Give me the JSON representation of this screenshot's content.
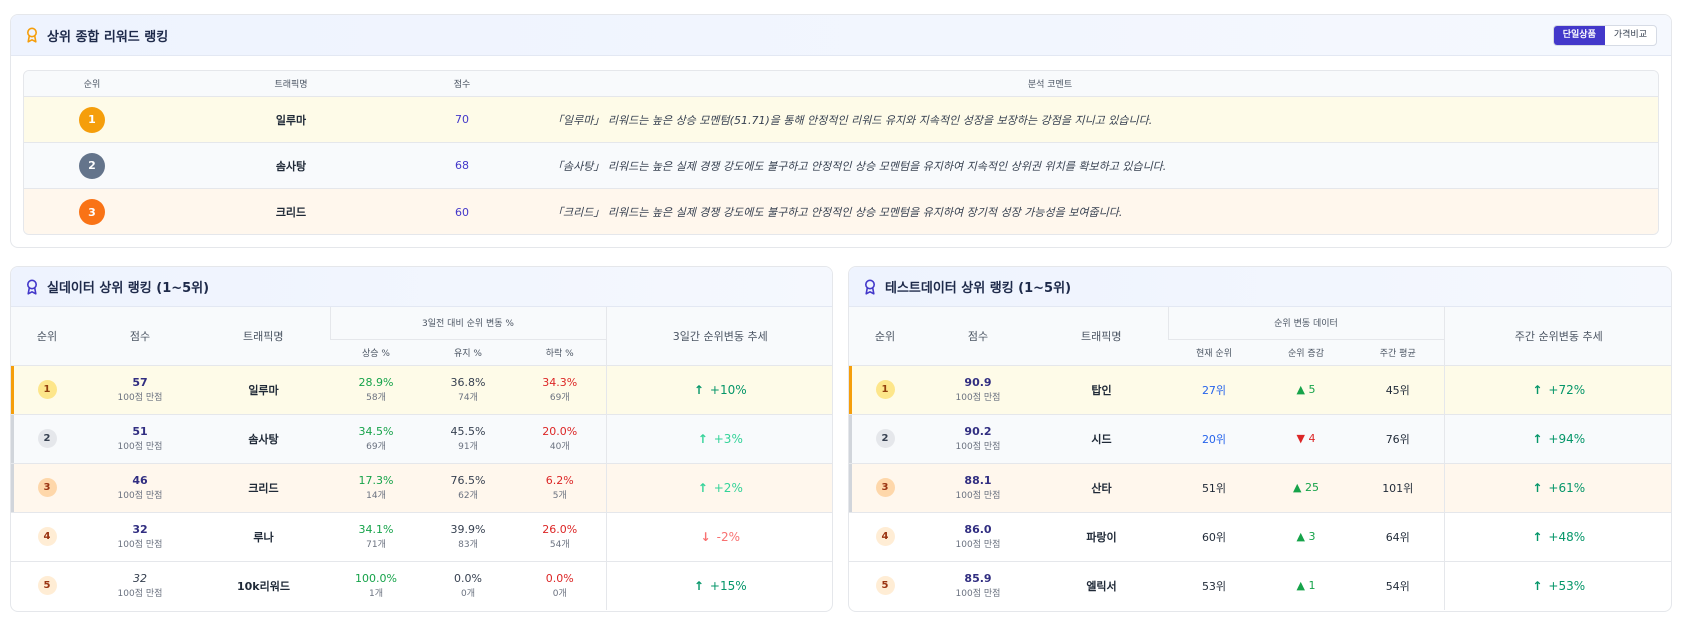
{
  "top": {
    "title": "상위 종합 리워드 랭킹",
    "toggle": [
      "단일상품",
      "가격비교"
    ],
    "headers": {
      "rank": "순위",
      "name": "트래픽명",
      "score": "점수",
      "comment": "분석 코멘트"
    },
    "rows": [
      {
        "rank": "1",
        "name": "일루마",
        "score": "70",
        "comment": "「일루마」 리워드는 높은 상승 모멘텀(51.71)을 통해 안정적인 리워드 유지와 지속적인 성장을 보장하는 강점을 지니고 있습니다.",
        "medal_color": "#f59e0b",
        "bg": "#fefbe8"
      },
      {
        "rank": "2",
        "name": "솜사탕",
        "score": "68",
        "comment": "「솜사탕」 리워드는 높은 실제 경쟁 강도에도 불구하고 안정적인 상승 모멘텀을 유지하여 지속적인 상위권 위치를 확보하고 있습니다.",
        "medal_color": "#64748b",
        "bg": "#f8fafc"
      },
      {
        "rank": "3",
        "name": "크리드",
        "score": "60",
        "comment": "「크리드」 리워드는 높은 실제 경쟁 강도에도 불구하고 안정적인 상승 모멘텀을 유지하여 장기적 성장 가능성을 보여줍니다.",
        "medal_color": "#f97316",
        "bg": "#fff7ed"
      }
    ]
  },
  "real": {
    "title": "실데이터 상위 랭킹 (1~5위)",
    "headers": {
      "rank": "순위",
      "score": "점수",
      "name": "트래픽명",
      "group": "3일전 대비 순위 변동 %",
      "up": "상승 %",
      "keep": "유지 %",
      "down": "하락 %",
      "trend": "3일간 순위변동 추세"
    },
    "rows": [
      {
        "rank": "1",
        "score": "57",
        "score_sub": "100점 만점",
        "name": "일루마",
        "up": "28.9%",
        "up_cnt": "58개",
        "keep": "36.8%",
        "keep_cnt": "74개",
        "down": "34.3%",
        "down_cnt": "69개",
        "trend_arrow": "↑",
        "trend": "+10%"
      },
      {
        "rank": "2",
        "score": "51",
        "score_sub": "100점 만점",
        "name": "솜사탕",
        "up": "34.5%",
        "up_cnt": "69개",
        "keep": "45.5%",
        "keep_cnt": "91개",
        "down": "20.0%",
        "down_cnt": "40개",
        "trend_arrow": "↑",
        "trend": "+3%"
      },
      {
        "rank": "3",
        "score": "46",
        "score_sub": "100점 만점",
        "name": "크리드",
        "up": "17.3%",
        "up_cnt": "14개",
        "keep": "76.5%",
        "keep_cnt": "62개",
        "down": "6.2%",
        "down_cnt": "5개",
        "trend_arrow": "↑",
        "trend": "+2%"
      },
      {
        "rank": "4",
        "score": "32",
        "score_sub": "100점 만점",
        "name": "루나",
        "up": "34.1%",
        "up_cnt": "71개",
        "keep": "39.9%",
        "keep_cnt": "83개",
        "down": "26.0%",
        "down_cnt": "54개",
        "trend_arrow": "↓",
        "trend": "-2%"
      },
      {
        "rank": "5",
        "score": "32",
        "score_sub": "100점 만점",
        "name": "10k리워드",
        "up": "100.0%",
        "up_cnt": "1개",
        "keep": "0.0%",
        "keep_cnt": "0개",
        "down": "0.0%",
        "down_cnt": "0개",
        "trend_arrow": "↑",
        "trend": "+15%"
      }
    ]
  },
  "test": {
    "title": "테스트데이터 상위 랭킹 (1~5위)",
    "headers": {
      "rank": "순위",
      "score": "점수",
      "name": "트래픽명",
      "group": "순위 변동 데이터",
      "current": "현재 순위",
      "change": "순위 증감",
      "avg": "주간 평균",
      "trend": "주간 순위변동 추세"
    },
    "rows": [
      {
        "rank": "1",
        "score": "90.9",
        "score_sub": "100점 만점",
        "name": "탑인",
        "current": "27위",
        "change_arrow": "▲",
        "change": "5",
        "avg": "45위",
        "trend_arrow": "↑",
        "trend": "+72%"
      },
      {
        "rank": "2",
        "score": "90.2",
        "score_sub": "100점 만점",
        "name": "시드",
        "current": "20위",
        "change_arrow": "▼",
        "change": "4",
        "avg": "76위",
        "trend_arrow": "↑",
        "trend": "+94%"
      },
      {
        "rank": "3",
        "score": "88.1",
        "score_sub": "100점 만점",
        "name": "산타",
        "current": "51위",
        "change_arrow": "▲",
        "change": "25",
        "avg": "101위",
        "trend_arrow": "↑",
        "trend": "+61%"
      },
      {
        "rank": "4",
        "score": "86.0",
        "score_sub": "100점 만점",
        "name": "파랑이",
        "current": "60위",
        "change_arrow": "▲",
        "change": "3",
        "avg": "64위",
        "trend_arrow": "↑",
        "trend": "+48%"
      },
      {
        "rank": "5",
        "score": "85.9",
        "score_sub": "100점 만점",
        "name": "엘릭서",
        "current": "53위",
        "change_arrow": "▲",
        "change": "1",
        "avg": "54위",
        "trend_arrow": "↑",
        "trend": "+53%"
      }
    ]
  },
  "colors": {
    "accent": "#4338ca",
    "up": "#16a34a",
    "down": "#dc2626",
    "gold": "#f59e0b"
  },
  "icons": {
    "panel": "award-ribbon-icon"
  }
}
